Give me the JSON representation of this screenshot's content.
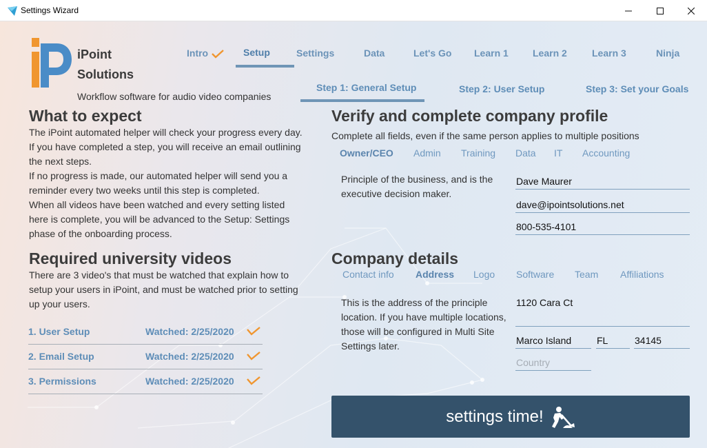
{
  "window": {
    "title": "Settings Wizard"
  },
  "brand": {
    "name_line1": "iPoint",
    "name_line2": "Solutions",
    "tagline": "Workflow software for audio video companies"
  },
  "nav": {
    "items": [
      {
        "label": "Intro",
        "done": true
      },
      {
        "label": "Setup",
        "active": true
      },
      {
        "label": "Settings"
      },
      {
        "label": "Data"
      },
      {
        "label": "Let's Go"
      },
      {
        "label": "Learn 1"
      },
      {
        "label": "Learn 2"
      },
      {
        "label": "Learn 3"
      },
      {
        "label": "Ninja"
      }
    ]
  },
  "steps": [
    {
      "label": "Step 1: General Setup",
      "active": true
    },
    {
      "label": "Step 2: User Setup"
    },
    {
      "label": "Step 3: Set your Goals"
    }
  ],
  "expect": {
    "title": "What to expect",
    "lines": [
      "The iPoint automated helper will check your progress every day.",
      "If you have completed a step, you will receive an email outlining",
      "the next steps.",
      "If no progress is made, our automated helper will send you a",
      "reminder every two weeks until this step is completed.",
      "When all videos have been watched and every setting listed",
      "here is complete, you will be advanced to the Setup: Settings",
      "phase of the onboarding process."
    ]
  },
  "videos": {
    "title": "Required university videos",
    "lines": [
      "There are 3 video's that must be watched that explain how to",
      "setup your users in iPoint, and must be watched prior to setting",
      "up your users."
    ],
    "items": [
      {
        "name": "1. User Setup",
        "status": "Watched: 2/25/2020"
      },
      {
        "name": "2. Email Setup",
        "status": "Watched: 2/25/2020"
      },
      {
        "name": "3. Permissions",
        "status": "Watched: 2/25/2020"
      }
    ]
  },
  "profile": {
    "title": "Verify and complete company profile",
    "subtitle": "Complete all fields, even if the same person applies to multiple positions",
    "tabs": [
      "Owner/CEO",
      "Admin",
      "Training",
      "Data",
      "IT",
      "Accounting"
    ],
    "active_tab": "Owner/CEO",
    "description_lines": [
      "Principle of the business, and is the",
      "executive decision maker."
    ],
    "name": "Dave Maurer",
    "email": "dave@ipointsolutions.net",
    "phone": "800-535-4101"
  },
  "company": {
    "title": "Company details",
    "tabs": [
      "Contact info",
      "Address",
      "Logo",
      "Software",
      "Team",
      "Affiliations"
    ],
    "active_tab": "Address",
    "description_lines": [
      "This is the address of the principle",
      "location. If you have multiple locations,",
      "those will be configured in Multi Site",
      "Settings later."
    ],
    "street": "1120 Cara Ct",
    "city": "Marco Island",
    "state": "FL",
    "zip": "34145",
    "country_placeholder": "Country"
  },
  "action": {
    "label": "settings time!"
  },
  "colors": {
    "accent": "#5e8db7",
    "check_orange": "#f0962f",
    "button_bg": "#34526b",
    "logo_orange": "#f0962f",
    "logo_blue": "#4a8cc7"
  }
}
